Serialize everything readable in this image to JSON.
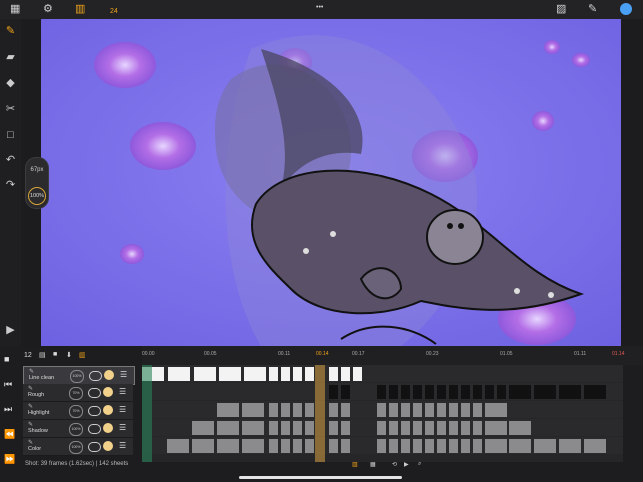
{
  "topbar": {
    "frame_count": "24",
    "more": "•••"
  },
  "tools": {
    "pencil": "✎",
    "eraser": "▰",
    "fill": "◆",
    "lasso": "✂",
    "select": "□",
    "undo": "↶",
    "redo": "↷",
    "play": "▶"
  },
  "brush": {
    "size": "67px",
    "opacity": "100%"
  },
  "timeline": {
    "frame_number": "12",
    "ruler_ticks": [
      "00.00",
      "00.05",
      "00.11",
      "00.14",
      "00.17",
      "00.23",
      "01.05",
      "01.11",
      "01.14"
    ],
    "layers": [
      {
        "name": "Line clean",
        "opacity": "100%"
      },
      {
        "name": "Rough",
        "opacity": "70%"
      },
      {
        "name": "Highlight",
        "opacity": "70%"
      },
      {
        "name": "Shadow",
        "opacity": "100%"
      },
      {
        "name": "Color",
        "opacity": "100%"
      }
    ]
  },
  "status": {
    "text": "Shot: 39 frames (1.62sec) | 142 sheets"
  },
  "colors": {
    "accent": "#f2a51a",
    "canvas_bg": "#7b6fea",
    "playhead": "#d6a042",
    "creature_body": "#5a5168"
  }
}
